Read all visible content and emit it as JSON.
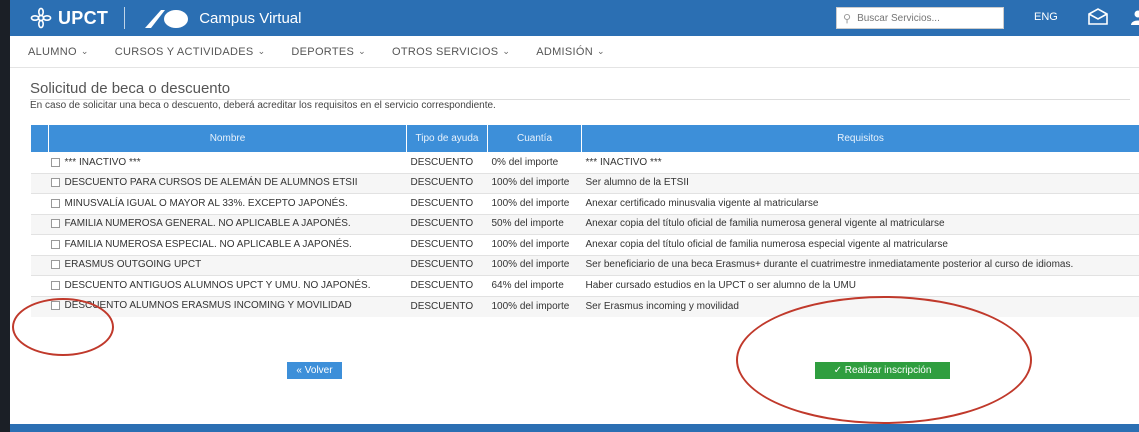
{
  "header": {
    "brand": "UPCT",
    "app_title": "Campus Virtual",
    "search_placeholder": "Buscar Servicios...",
    "language": "ENG",
    "icons": [
      "flower-logo-icon",
      "campus-virtual-logo-icon",
      "search-icon",
      "mail-icon"
    ]
  },
  "nav": {
    "items": [
      {
        "label": "ALUMNO"
      },
      {
        "label": "CURSOS Y ACTIVIDADES"
      },
      {
        "label": "DEPORTES"
      },
      {
        "label": "OTROS SERVICIOS"
      },
      {
        "label": "ADMISIÓN"
      }
    ]
  },
  "main": {
    "title": "Solicitud de beca o descuento",
    "intro": "En caso de solicitar una beca o descuento, deberá acreditar los requisitos en el servicio correspondiente.",
    "table": {
      "headers": {
        "nombre": "Nombre",
        "tipo": "Tipo de ayuda",
        "cuantia": "Cuantía",
        "requisitos": "Requisitos"
      },
      "rows": [
        {
          "nombre": "*** INACTIVO ***",
          "tipo": "DESCUENTO",
          "cuantia": "0% del importe",
          "requisitos": "*** INACTIVO ***"
        },
        {
          "nombre": "DESCUENTO PARA CURSOS DE ALEMÁN DE ALUMNOS ETSII",
          "tipo": "DESCUENTO",
          "cuantia": "100% del importe",
          "requisitos": "Ser alumno de la ETSII"
        },
        {
          "nombre": "MINUSVALÍA IGUAL O MAYOR AL 33%. EXCEPTO JAPONÉS.",
          "tipo": "DESCUENTO",
          "cuantia": "100% del importe",
          "requisitos": "Anexar certificado minusvalia vigente al matricularse"
        },
        {
          "nombre": "FAMILIA NUMEROSA GENERAL. NO APLICABLE A JAPONÉS.",
          "tipo": "DESCUENTO",
          "cuantia": "50% del importe",
          "requisitos": "Anexar copia del título oficial de familia numerosa general vigente al matricularse"
        },
        {
          "nombre": "FAMILIA NUMEROSA ESPECIAL. NO APLICABLE A JAPONÉS.",
          "tipo": "DESCUENTO",
          "cuantia": "100% del importe",
          "requisitos": "Anexar copia del título oficial de familia numerosa especial vigente al matricularse"
        },
        {
          "nombre": "ERASMUS OUTGOING UPCT",
          "tipo": "DESCUENTO",
          "cuantia": "100% del importe",
          "requisitos": "Ser beneficiario de una beca Erasmus+ durante el cuatrimestre inmediatamente posterior al curso de idiomas."
        },
        {
          "nombre": "DESCUENTO ANTIGUOS ALUMNOS UPCT Y UMU. NO JAPONÉS.",
          "tipo": "DESCUENTO",
          "cuantia": "64% del importe",
          "requisitos": "Haber cursado estudios en la UPCT o ser alumno de la UMU"
        },
        {
          "nombre": "DESCUENTO ALUMNOS ERASMUS INCOMING Y MOVILIDAD",
          "tipo": "DESCUENTO",
          "cuantia": "100% del importe",
          "requisitos": "Ser Erasmus incoming y movilidad"
        }
      ]
    },
    "buttons": {
      "volver": "« Volver",
      "realizar": "✓ Realizar inscripción"
    }
  },
  "colors": {
    "header_blue": "#2b6fb3",
    "table_header_blue": "#3d8fd9",
    "success_green": "#2f9e3f",
    "annotation_red": "#c0392b"
  }
}
